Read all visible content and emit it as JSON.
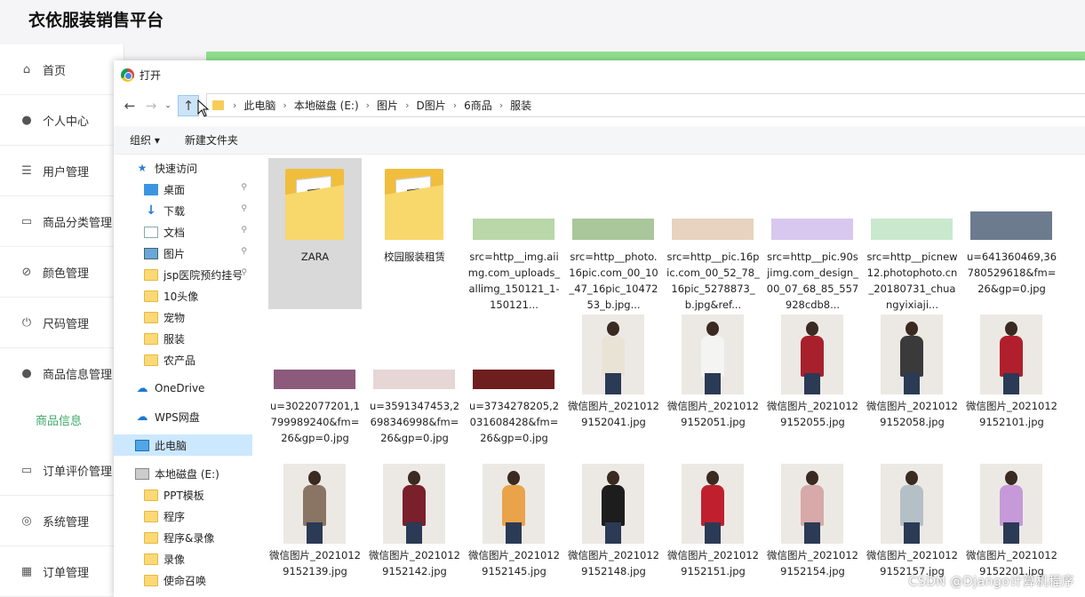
{
  "app": {
    "title": "衣依服装销售平台"
  },
  "sidebar": {
    "items": [
      {
        "label": "首页",
        "icon": "home-icon"
      },
      {
        "label": "个人中心",
        "icon": "person-icon"
      },
      {
        "label": "用户管理",
        "icon": "list-icon"
      },
      {
        "label": "商品分类管理",
        "icon": "monitor-icon"
      },
      {
        "label": "颜色管理",
        "icon": "bell-off-icon"
      },
      {
        "label": "尺码管理",
        "icon": "power-icon"
      },
      {
        "label": "商品信息管理",
        "icon": "person-icon"
      },
      {
        "label": "订单评价管理",
        "icon": "monitor-icon"
      },
      {
        "label": "系统管理",
        "icon": "target-icon"
      },
      {
        "label": "订单管理",
        "icon": "grid-icon"
      }
    ],
    "sub_item": "商品信息"
  },
  "dialog": {
    "title": "打开",
    "breadcrumb": [
      "此电脑",
      "本地磁盘 (E:)",
      "图片",
      "D图片",
      "6商品",
      "服装"
    ],
    "commands": {
      "organize": "组织 ▾",
      "new_folder": "新建文件夹"
    },
    "nav": [
      {
        "label": "快速访问",
        "icon": "star-icon",
        "indent": 1
      },
      {
        "label": "桌面",
        "icon": "desktop-icon",
        "indent": 2,
        "pinned": true
      },
      {
        "label": "下载",
        "icon": "download-icon",
        "indent": 2,
        "pinned": true
      },
      {
        "label": "文档",
        "icon": "document-icon",
        "indent": 2,
        "pinned": true
      },
      {
        "label": "图片",
        "icon": "picture-icon",
        "indent": 2,
        "pinned": true
      },
      {
        "label": "jsp医院预约挂号",
        "icon": "folder-icon",
        "indent": 2,
        "pinned": true
      },
      {
        "label": "10头像",
        "icon": "folder-icon",
        "indent": 2
      },
      {
        "label": "宠物",
        "icon": "folder-icon",
        "indent": 2
      },
      {
        "label": "服装",
        "icon": "folder-icon",
        "indent": 2
      },
      {
        "label": "农产品",
        "icon": "folder-icon",
        "indent": 2
      },
      {
        "label": "OneDrive",
        "icon": "cloud-icon",
        "indent": 1
      },
      {
        "label": "WPS网盘",
        "icon": "cloud-icon",
        "indent": 1
      },
      {
        "label": "此电脑",
        "icon": "computer-icon",
        "indent": 1,
        "selected": true
      },
      {
        "label": "本地磁盘 (E:)",
        "icon": "drive-icon",
        "indent": 1
      },
      {
        "label": "PPT模板",
        "icon": "folder-icon",
        "indent": 2
      },
      {
        "label": "程序",
        "icon": "folder-icon",
        "indent": 2
      },
      {
        "label": "程序&录像",
        "icon": "folder-icon",
        "indent": 2
      },
      {
        "label": "录像",
        "icon": "folder-icon",
        "indent": 2
      },
      {
        "label": "使命召唤",
        "icon": "folder-icon",
        "indent": 2
      }
    ],
    "files": [
      {
        "name": "ZARA",
        "kind": "folder",
        "selected": true
      },
      {
        "name": "校园服装租赁",
        "kind": "folder"
      },
      {
        "name": "src=http__img.aiimg.com_uploads_allimg_150121_1-150121...",
        "kind": "banner",
        "color": "#b9d7a8"
      },
      {
        "name": "src=http__photo.16pic.com_00_10_47_16pic_1047253_b.jpg...",
        "kind": "banner",
        "color": "#a9c79a"
      },
      {
        "name": "src=http__pic.16pic.com_00_52_78_16pic_5278873_b.jpg&ref...",
        "kind": "banner",
        "color": "#e8d2c0"
      },
      {
        "name": "src=http__pic.90sjimg.com_design_00_07_68_85_557928cdb8...",
        "kind": "banner",
        "color": "#d8c7ef"
      },
      {
        "name": "src=http__picnew12.photophoto.cn_20180731_chuangyixiaji...",
        "kind": "banner",
        "color": "#c9e8cd"
      },
      {
        "name": "u=641360469,36780529618&fm=26&gp=0.jpg",
        "kind": "banner",
        "color": "#6d7b8f"
      },
      {
        "name": "u=3022077201,1799989240&fm=26&gp=0.jpg",
        "kind": "banner",
        "color": "#8c5a7a"
      },
      {
        "name": "u=3591347453,2698346998&fm=26&gp=0.jpg",
        "kind": "banner",
        "color": "#e7d6d6"
      },
      {
        "name": "u=3734278205,2031608428&fm=26&gp=0.jpg",
        "kind": "banner",
        "color": "#6e1e1e"
      },
      {
        "name": "微信图片_20210129152041.jpg",
        "kind": "photo",
        "color": "#e9e3d6"
      },
      {
        "name": "微信图片_20210129152051.jpg",
        "kind": "photo",
        "color": "#f4f4f2"
      },
      {
        "name": "微信图片_20210129152055.jpg",
        "kind": "photo",
        "color": "#a8202c"
      },
      {
        "name": "微信图片_20210129152058.jpg",
        "kind": "photo",
        "color": "#3a3a3a"
      },
      {
        "name": "微信图片_20210129152101.jpg",
        "kind": "photo",
        "color": "#b21f2c"
      },
      {
        "name": "微信图片_20210129152139.jpg",
        "kind": "photo",
        "color": "#8a7564"
      },
      {
        "name": "微信图片_20210129152142.jpg",
        "kind": "photo",
        "color": "#7a1f2c"
      },
      {
        "name": "微信图片_20210129152145.jpg",
        "kind": "photo",
        "color": "#e9a34a"
      },
      {
        "name": "微信图片_20210129152148.jpg",
        "kind": "photo",
        "color": "#1d1d1d"
      },
      {
        "name": "微信图片_20210129152151.jpg",
        "kind": "photo",
        "color": "#c0202e"
      },
      {
        "name": "微信图片_20210129152154.jpg",
        "kind": "photo",
        "color": "#d7a9a9"
      },
      {
        "name": "微信图片_20210129152157.jpg",
        "kind": "photo",
        "color": "#b5bfc6"
      },
      {
        "name": "微信图片_20210129152201.jpg",
        "kind": "photo",
        "color": "#c69ad8"
      }
    ]
  },
  "watermark": "CSDN @Django计算机程序"
}
